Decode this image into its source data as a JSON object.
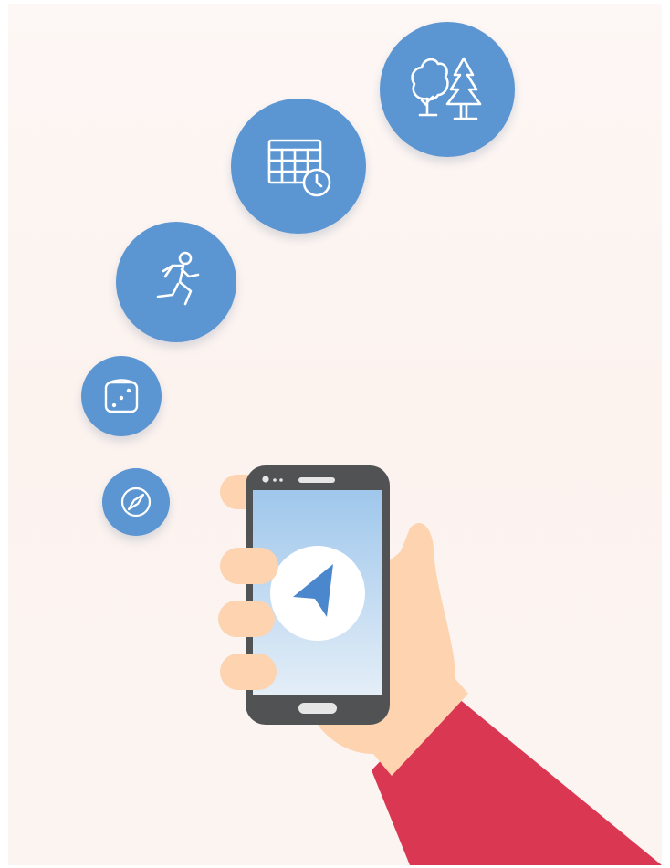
{
  "colors": {
    "background": "#fcf4f1",
    "bubble": "#5b95d2",
    "skin": "#fdd3b0",
    "sleeve": "#da3753",
    "phone_body": "#505253",
    "screen_top": "#9fc7ec",
    "screen_bottom": "#e4eef7",
    "nav_arrow": "#4a87cc"
  },
  "icons": [
    {
      "name": "trees-icon"
    },
    {
      "name": "calendar-clock-icon"
    },
    {
      "name": "runner-icon"
    },
    {
      "name": "dice-icon"
    },
    {
      "name": "compass-icon"
    },
    {
      "name": "navigation-arrow-icon"
    }
  ]
}
